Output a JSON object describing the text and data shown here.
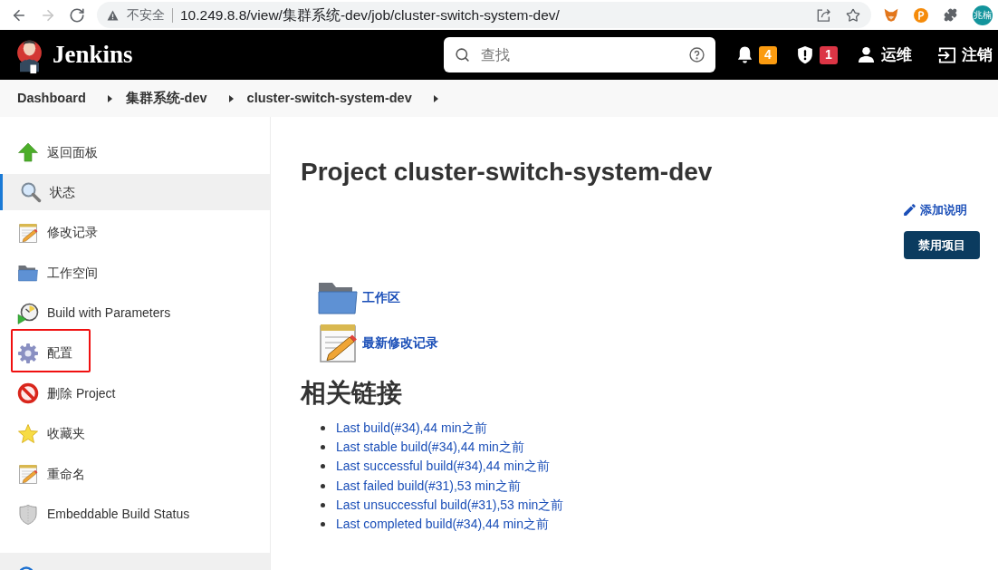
{
  "browser": {
    "nav": [
      {
        "kind": "back",
        "disabled": false
      },
      {
        "kind": "forward",
        "disabled": true
      },
      {
        "kind": "reload",
        "disabled": false
      }
    ],
    "security_label": "不安全",
    "url": "10.249.8.8/view/集群系统-dev/job/cluster-switch-system-dev/",
    "profile_initials": "兆楠"
  },
  "header": {
    "logo_text": "Jenkins",
    "search": {
      "placeholder": "查找"
    },
    "notification_count": "4",
    "security_count": "1",
    "user": "运维",
    "logout": "注销"
  },
  "breadcrumbs": [
    "Dashboard",
    "集群系统-dev",
    "cluster-switch-system-dev"
  ],
  "sidebar": {
    "items": [
      {
        "label": "返回面板",
        "kind": "up",
        "selected": false,
        "highlighted": false
      },
      {
        "label": "状态",
        "kind": "search",
        "selected": true,
        "highlighted": false
      },
      {
        "label": "修改记录",
        "kind": "notepad",
        "selected": false,
        "highlighted": false
      },
      {
        "label": "工作空间",
        "kind": "folder",
        "selected": false,
        "highlighted": false
      },
      {
        "label": "Build with Parameters",
        "kind": "build",
        "selected": false,
        "highlighted": false
      },
      {
        "label": "配置",
        "kind": "gear",
        "selected": false,
        "highlighted": true
      },
      {
        "label": "删除 Project",
        "kind": "delete",
        "selected": false,
        "highlighted": false
      },
      {
        "label": "收藏夹",
        "kind": "star",
        "selected": false,
        "highlighted": false
      },
      {
        "label": "重命名",
        "kind": "notepad",
        "selected": false,
        "highlighted": false
      },
      {
        "label": "Embeddable Build Status",
        "kind": "shield",
        "selected": false,
        "highlighted": false
      }
    ]
  },
  "main": {
    "title": "Project cluster-switch-system-dev",
    "add_description": "添加说明",
    "disable_button": "禁用项目",
    "links": [
      {
        "kind": "folder",
        "label": "工作区"
      },
      {
        "kind": "notepad",
        "label": "最新修改记录"
      }
    ],
    "related": {
      "heading": "相关链接",
      "items": [
        "Last build(#34),44 min之前",
        "Last stable build(#34),44 min之前",
        "Last successful build(#34),44 min之前",
        "Last failed build(#31),53 min之前",
        "Last unsuccessful build(#31),53 min之前",
        "Last completed build(#34),44 min之前"
      ]
    }
  }
}
